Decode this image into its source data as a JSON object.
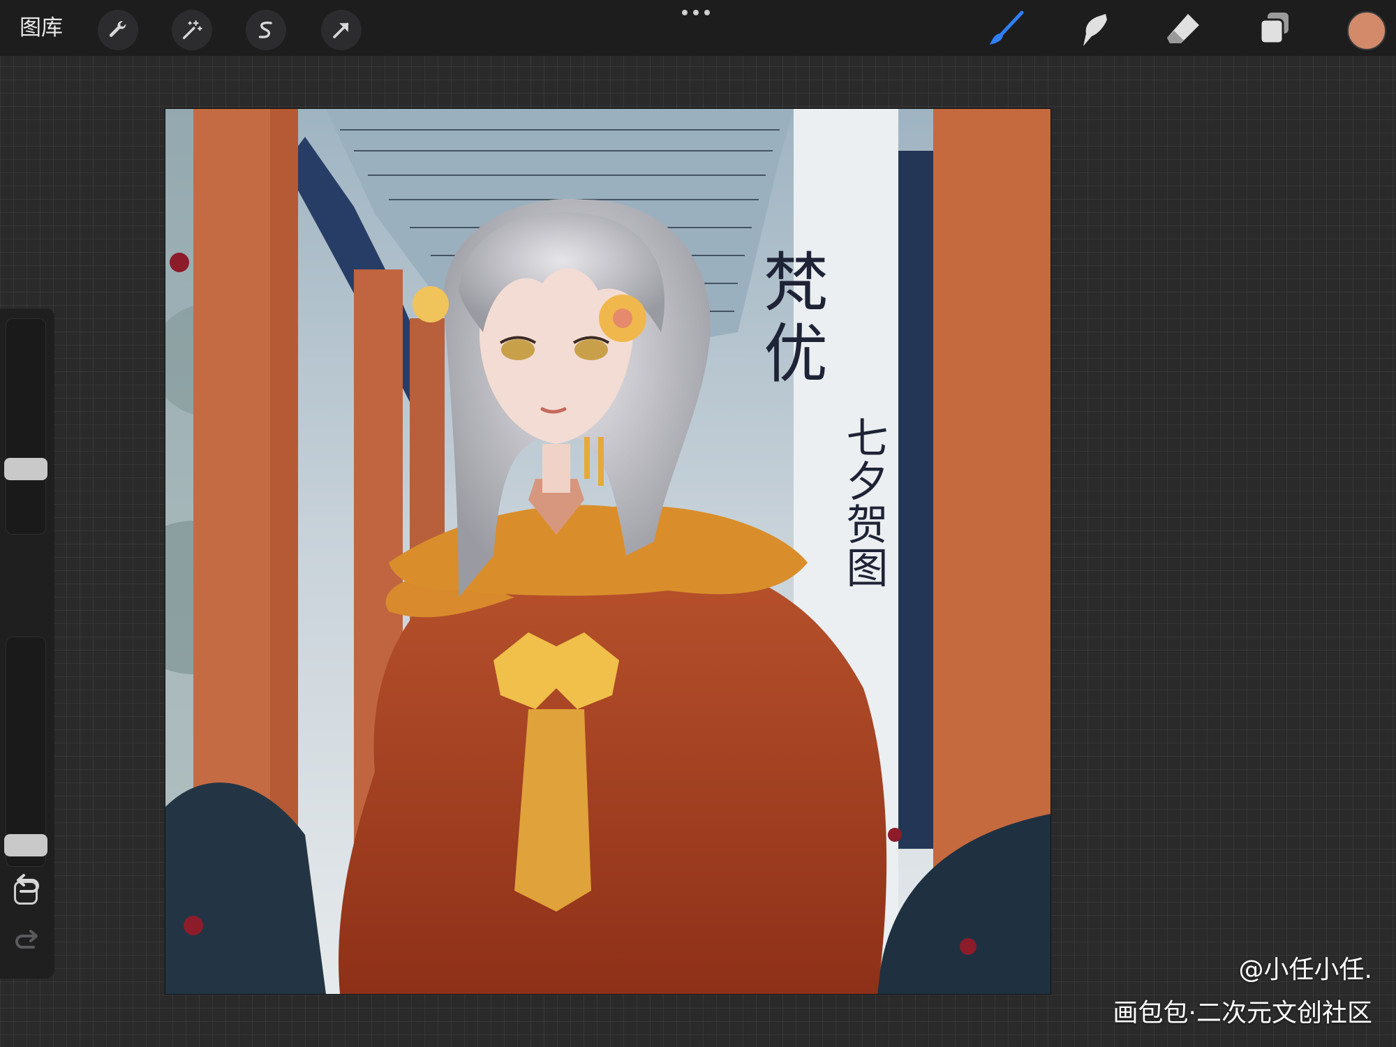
{
  "topbar": {
    "gallery_label": "图库",
    "tools_left": [
      "wrench-icon",
      "magic-wand-icon",
      "selection-s-icon",
      "transform-arrow-icon"
    ],
    "tools_right": [
      "brush-icon",
      "smudge-icon",
      "eraser-icon",
      "layers-icon"
    ],
    "current_color": "#d28a6b",
    "accent": "#2f7ff5"
  },
  "sidebar": {
    "brush_size_level": 0.28,
    "opacity_level": 0.05
  },
  "artwork": {
    "title_main": "梵优",
    "title_sub": "七夕贺图"
  },
  "watermark": {
    "author": "@小任小任.",
    "site": "画包包·二次元文创社区"
  }
}
